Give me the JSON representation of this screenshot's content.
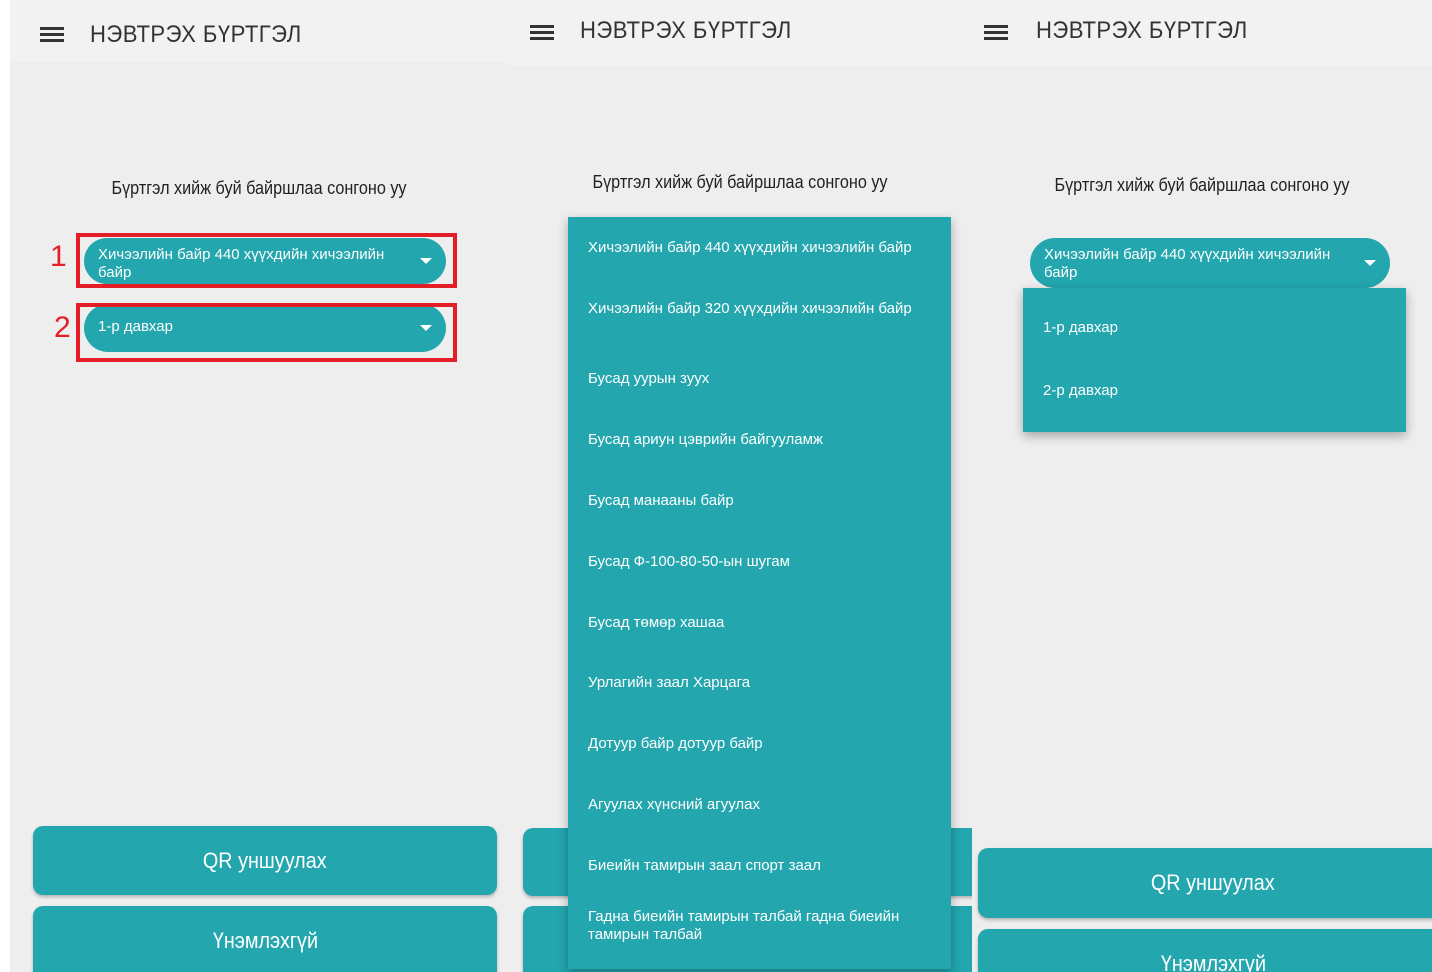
{
  "app": {
    "title": "НЭВТРЭХ БҮРТГЭЛ"
  },
  "form": {
    "prompt": "Бүртгэл хийж буй байршлаа сонгоно уу"
  },
  "selects": {
    "location_value": "Хичээлийн байр 440 хүүхдийн хичээлийн байр",
    "floor_value": "1-р давхар"
  },
  "annotations": {
    "marker_1": "1",
    "marker_2": "2"
  },
  "buttons": {
    "qr_label": "QR уншуулах",
    "certificate_label": "Үнэмлэхгүй"
  },
  "location_options": [
    "Хичээлийн байр 440 хүүхдийн хичээлийн байр",
    "Хичээлийн байр 320 хүүхдийн хичээлийн байр",
    "Бусад уурын зуух",
    "Бусад ариун цэврийн байгууламж",
    "Бусад манааны байр",
    "Бусад Ф-100-80-50-ын шугам",
    "Бусад төмөр хашаа",
    "Урлагийн заал Харцага",
    "Дотуур байр дотуур байр",
    "Агуулах хүнсний агуулах",
    "Биеийн тамирын заал спорт заал",
    "Гадна биеийн тамирын талбай гадна биеийн тамирын талбай"
  ],
  "floor_options": [
    "1-р давхар",
    "2-р давхар"
  ],
  "colors": {
    "accent": "#23a6ae",
    "highlight": "#e41e26",
    "background": "#eeeeee"
  }
}
